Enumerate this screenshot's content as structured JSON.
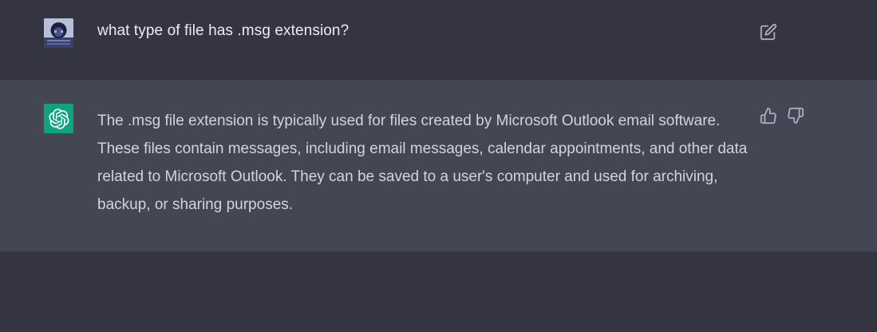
{
  "conversation": {
    "user_message": "what type of file has .msg extension?",
    "assistant_message": "The .msg file extension is typically used for files created by Microsoft Outlook email software. These files contain messages, including email messages, calendar appointments, and other data related to Microsoft Outlook. They can be saved to a user's computer and used for archiving, backup, or sharing purposes."
  },
  "icons": {
    "user_avatar": "user-avatar",
    "edit": "edit-icon",
    "assistant_logo": "openai-logo-icon",
    "like": "thumbs-up-icon",
    "dislike": "thumbs-down-icon"
  },
  "colors": {
    "background": "#343541",
    "assistant_background": "#444654",
    "logo_green": "#10a37f",
    "user_text": "#ececf1",
    "assistant_text": "#d1d5db",
    "icon_gray": "#acacbe"
  }
}
